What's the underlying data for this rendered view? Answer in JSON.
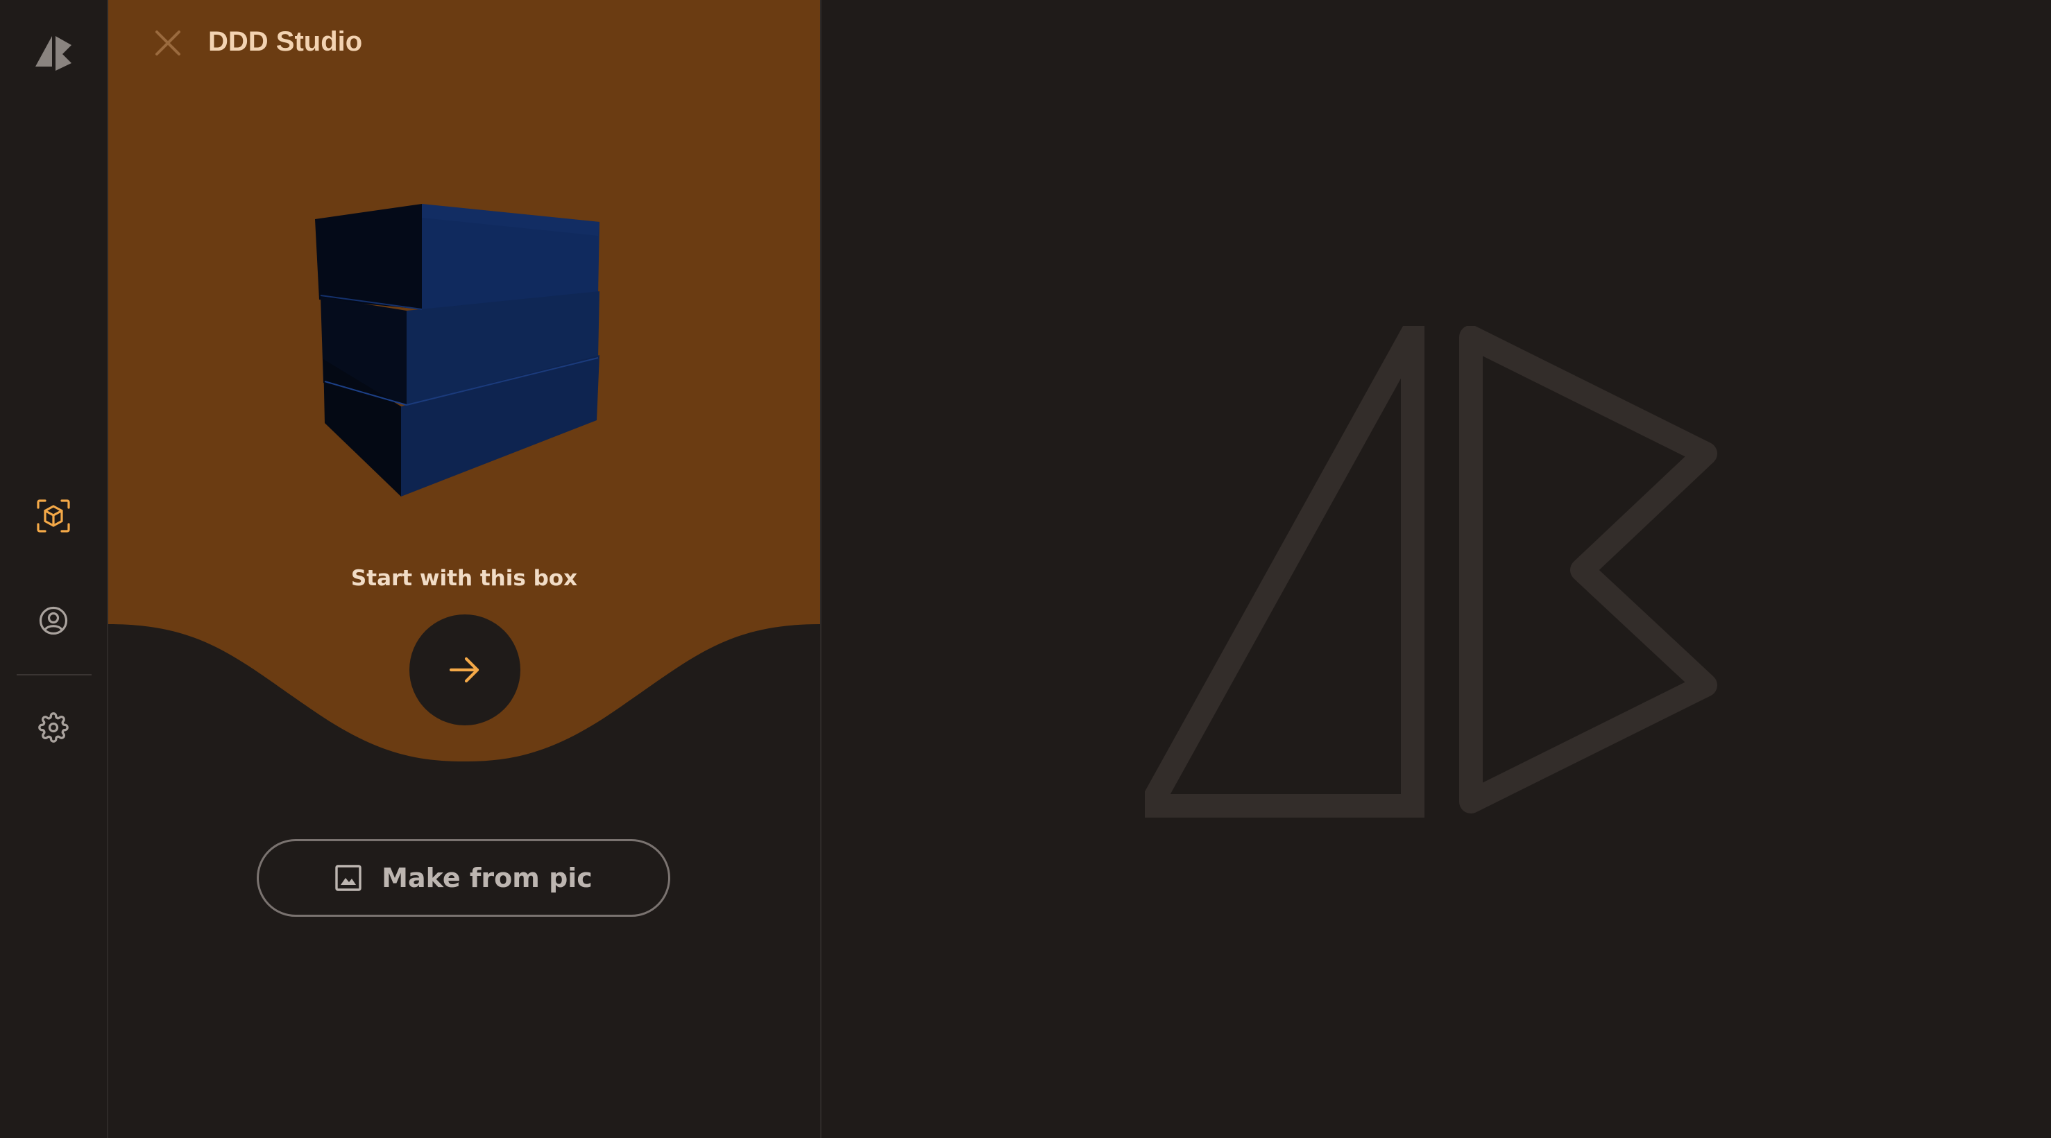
{
  "app": {
    "title": "DDD Studio"
  },
  "rail": {
    "items": [
      {
        "name": "studio",
        "icon": "cube-scan-icon",
        "active": true
      },
      {
        "name": "account",
        "icon": "user-circle-icon",
        "active": false
      },
      {
        "name": "settings",
        "icon": "gear-icon",
        "active": false
      }
    ]
  },
  "panel": {
    "title": "DDD Studio",
    "start_label": "Start with this box",
    "start_button_icon": "arrow-right-icon",
    "make_from_pic_label": "Make from pic",
    "make_from_pic_icon": "image-icon"
  },
  "colors": {
    "background": "#1f1b19",
    "panel_accent": "#6b3c12",
    "accent_orange": "#f4a948",
    "logo_outline": "#332d2a",
    "box_front": "#040b1a",
    "box_side": "#0f2858"
  }
}
